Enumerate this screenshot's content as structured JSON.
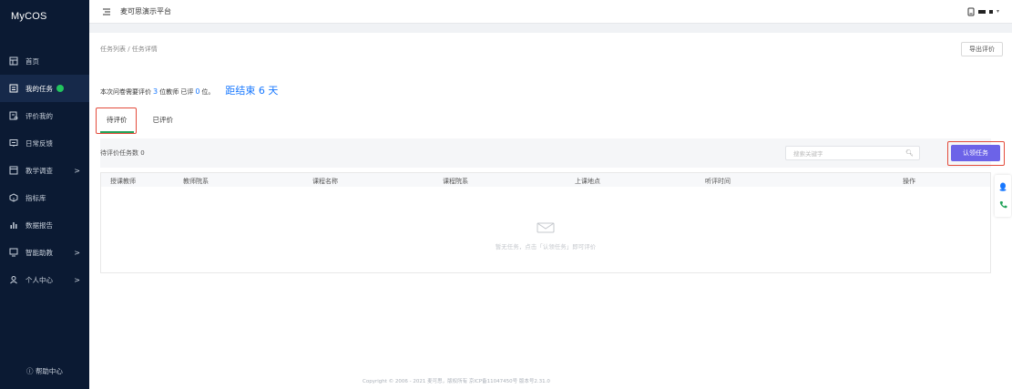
{
  "logo": "MyCOS",
  "header": {
    "title": "麦可思演示平台"
  },
  "sidebar": {
    "items": [
      {
        "label": "首页",
        "icon": "home-icon"
      },
      {
        "label": "我的任务",
        "icon": "task-icon",
        "active": true,
        "badge": true
      },
      {
        "label": "评价我的",
        "icon": "evaluate-icon"
      },
      {
        "label": "日常反馈",
        "icon": "feedback-icon"
      },
      {
        "label": "教学调查",
        "icon": "survey-icon",
        "arrow": ">"
      },
      {
        "label": "指标库",
        "icon": "cube-icon"
      },
      {
        "label": "数据报告",
        "icon": "chart-icon"
      },
      {
        "label": "智能助教",
        "icon": "assistant-icon",
        "arrow": ">"
      },
      {
        "label": "个人中心",
        "icon": "user-icon",
        "arrow": ">"
      }
    ],
    "help": "帮助中心"
  },
  "breadcrumb": "任务列表 / 任务详情",
  "export_button": "导出评价",
  "summary": {
    "prefix": "本次问卷需要评价",
    "teachers": "3",
    "mid": "位教师 已评",
    "done": "0",
    "suffix": "位。",
    "deadline": "距结束 6 天"
  },
  "tabs": [
    "待评价",
    "已评价"
  ],
  "toolbar": {
    "count_label": "待评价任务数 0",
    "search_placeholder": "搜索关键字",
    "claim_button": "认领任务"
  },
  "table": {
    "columns": [
      "授课教师",
      "教师院系",
      "课程名称",
      "课程院系",
      "上课地点",
      "听评时间",
      "操作"
    ],
    "empty_text": "暂无任务，点击「认领任务」即可评价"
  },
  "footer": "Copyright © 2006 - 2021 麦可思，版权所有 京ICP备11047450号 版本号2.31.0",
  "colors": {
    "sidebar_bg": "#0b1a33",
    "accent": "#6c63e8",
    "link": "#1677ff",
    "active_tab": "#22a35a",
    "highlight": "#e34b3b"
  }
}
